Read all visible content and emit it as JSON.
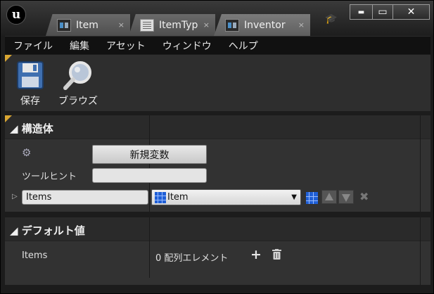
{
  "window": {
    "tabs": [
      {
        "label": "Item"
      },
      {
        "label": "ItemTyp"
      },
      {
        "label": "Inventor"
      }
    ],
    "tab_close_glyph": "×",
    "controls": {
      "minimize": "▬",
      "maximize": "▭",
      "close": "✕"
    }
  },
  "menu": [
    "ファイル",
    "編集",
    "アセット",
    "ウィンドウ",
    "ヘルプ"
  ],
  "toolbar": {
    "save_label": "保存",
    "browse_label": "ブラウズ"
  },
  "struct_panel": {
    "title": "構造体",
    "new_variable_label": "新規変数",
    "tooltip_label": "ツールヒント",
    "tooltip_value": "",
    "member": {
      "name": "Items",
      "type": "Item"
    }
  },
  "defaults_panel": {
    "title": "デフォルト値",
    "row": {
      "name": "Items",
      "value": "0 配列エレメント"
    }
  },
  "colors": {
    "accent_gold": "#d9a632",
    "array_blue": "#1f5fd6"
  }
}
